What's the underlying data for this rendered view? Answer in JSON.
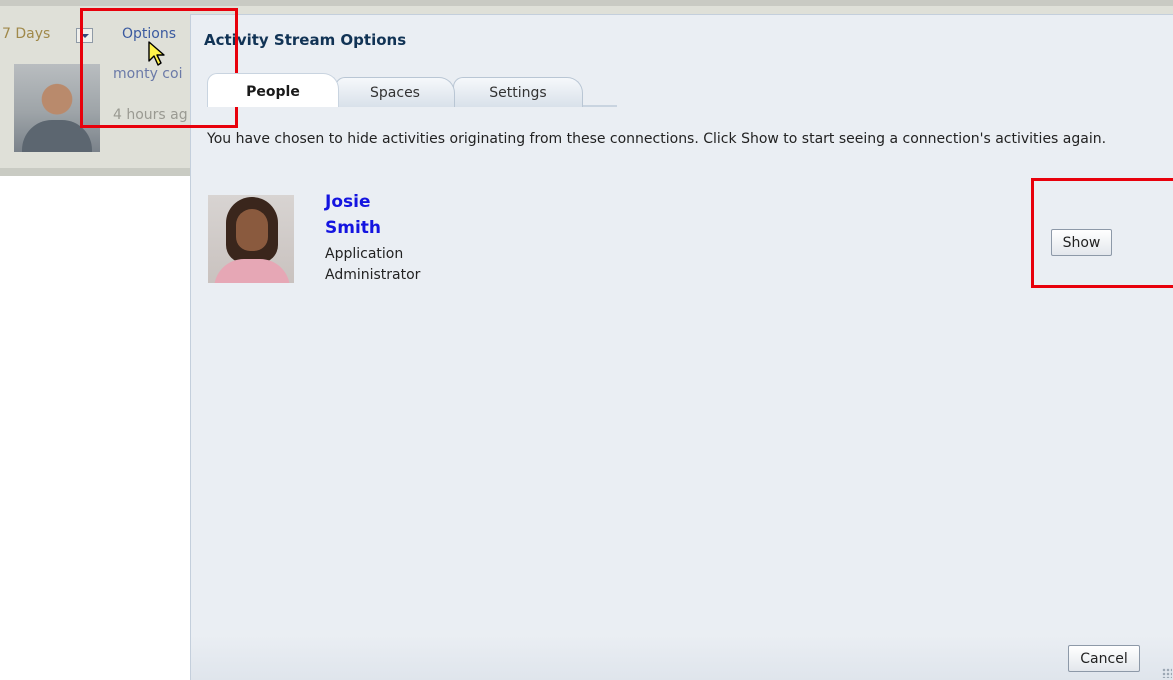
{
  "background": {
    "days_label": "7 Days",
    "options_link": "Options",
    "activity_name": "monty coi",
    "activity_time": "4 hours ag"
  },
  "dialog": {
    "title": "Activity Stream Options",
    "tabs": [
      {
        "label": "People",
        "selected": true
      },
      {
        "label": "Spaces",
        "selected": false
      },
      {
        "label": "Settings",
        "selected": false
      }
    ],
    "message": "You have chosen to hide activities originating from these connections. Click Show to start seeing a connection's activities again.",
    "person": {
      "first_name": "Josie",
      "last_name": "Smith",
      "role_line1": "Application",
      "role_line2": "Administrator"
    },
    "show_button": "Show",
    "cancel_button": "Cancel"
  },
  "colors": {
    "highlight": "#e8000b",
    "link_blue": "#1414e0",
    "dialog_bg": "#eaeef3",
    "title_color": "#113355"
  },
  "icons": [
    "dropdown-arrow-icon",
    "cursor-icon",
    "resize-grip-icon"
  ]
}
